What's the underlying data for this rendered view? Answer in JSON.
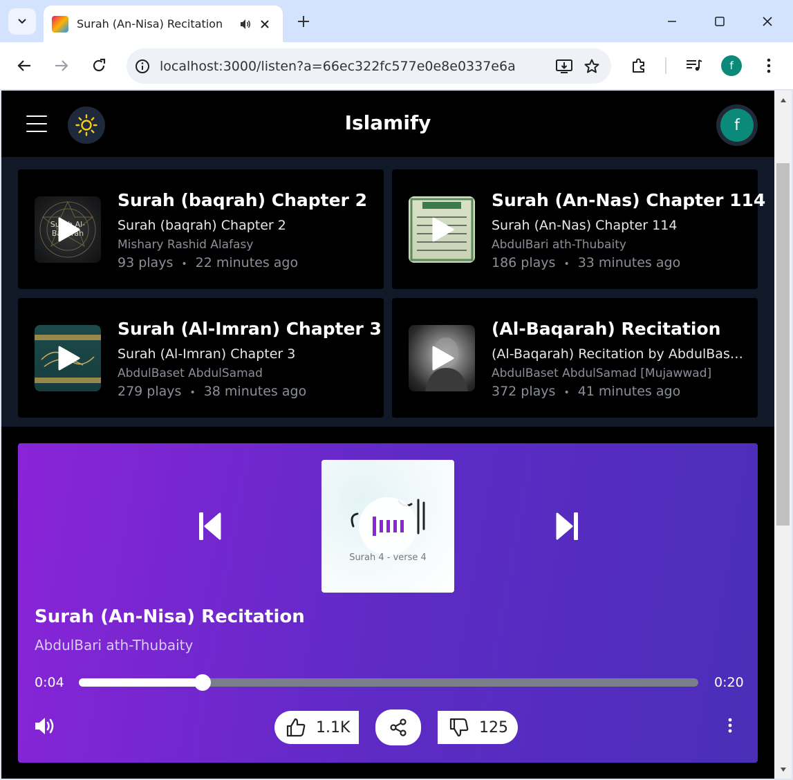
{
  "browser": {
    "tab_title": "Surah (An-Nisa) Recitation",
    "url": "localhost:3000/listen?a=66ec322fc577e0e8e0337e6a",
    "profile_initial": "f"
  },
  "app": {
    "title": "Islamify",
    "user_initial": "f"
  },
  "cards": [
    {
      "title": "Surah (baqrah) Chapter 2",
      "subtitle": "Surah (baqrah) Chapter 2",
      "artist": "Mishary Rashid Alafasy",
      "plays": "93 plays",
      "time": "22 minutes ago",
      "thumb_text": "Surah Al-Baqarah"
    },
    {
      "title": "Surah (An-Nas) Chapter 114",
      "subtitle": "Surah (An-Nas) Chapter 114",
      "artist": "AbdulBari ath-Thubaity",
      "plays": "186 plays",
      "time": "33 minutes ago"
    },
    {
      "title": "Surah (Al-Imran) Chapter 3",
      "subtitle": "Surah (Al-Imran) Chapter 3",
      "artist": "AbdulBaset AbdulSamad",
      "plays": "279 plays",
      "time": "38 minutes ago"
    },
    {
      "title": "(Al-Baqarah) Recitation",
      "subtitle": "(Al-Baqarah) Recitation by AbdulBaset AbdulSamad",
      "artist": "AbdulBaset AbdulSamad [Mujawwad]",
      "plays": "372 plays",
      "time": "41 minutes ago"
    }
  ],
  "player": {
    "art_caption": "Surah 4 - verse 4",
    "title": "Surah (An-Nisa) Recitation",
    "artist": "AbdulBari ath-Thubaity",
    "current_time": "0:04",
    "duration": "0:20",
    "progress": 0.2,
    "likes": "1.1K",
    "dislikes": "125"
  },
  "colors": {
    "player_gradient_start": "#8a24d8",
    "player_gradient_end": "#4a2fb8",
    "avatar": "#0b8a7a",
    "sun": "#facc15"
  },
  "icons": {
    "menu": "hamburger-icon",
    "theme": "sun-icon",
    "prev": "skip-previous-icon",
    "next": "skip-next-icon",
    "volume": "volume-icon",
    "like": "thumbs-up-icon",
    "share": "share-icon",
    "dislike": "thumbs-down-icon",
    "more": "more-vertical-icon"
  }
}
